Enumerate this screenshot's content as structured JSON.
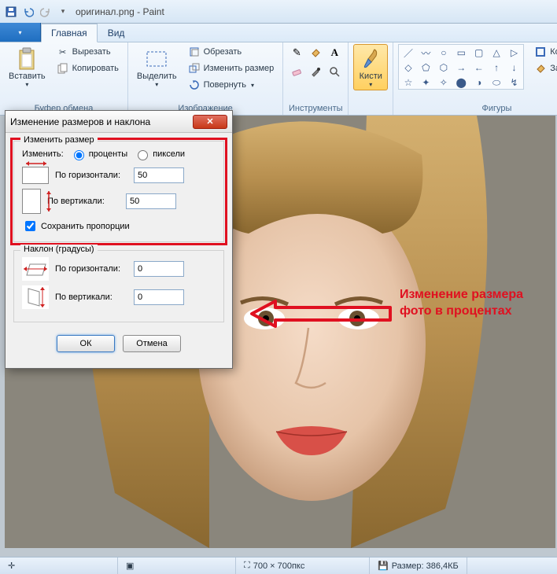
{
  "title": "оригинал.png - Paint",
  "tabs": {
    "file": "",
    "main": "Главная",
    "view": "Вид"
  },
  "ribbon": {
    "clipboard": {
      "label": "Буфер обмена",
      "paste": "Вставить",
      "cut": "Вырезать",
      "copy": "Копировать"
    },
    "image": {
      "label": "Изображение",
      "select": "Выделить",
      "crop": "Обрезать",
      "resize": "Изменить размер",
      "rotate": "Повернуть"
    },
    "tools": {
      "label": "Инструменты"
    },
    "brushes": {
      "label": "Кисти"
    },
    "shapes": {
      "label": "Фигуры",
      "outline": "Контур",
      "fill": "Заливка"
    }
  },
  "dialog": {
    "title": "Изменение размеров и наклона",
    "resize": {
      "legend": "Изменить размер",
      "by_label": "Изменить:",
      "percent": "проценты",
      "pixels": "пиксели",
      "horizontal": "По горизонтали:",
      "vertical": "По вертикали:",
      "h_value": "50",
      "v_value": "50",
      "keep_ratio": "Сохранить пропорции"
    },
    "skew": {
      "legend": "Наклон (градусы)",
      "horizontal": "По горизонтали:",
      "vertical": "По вертикали:",
      "h_value": "0",
      "v_value": "0"
    },
    "ok": "ОК",
    "cancel": "Отмена"
  },
  "annotation": "Изменение размера фото в процентах",
  "statusbar": {
    "dims": "700 × 700пкс",
    "size": "Размер: 386,4КБ"
  }
}
